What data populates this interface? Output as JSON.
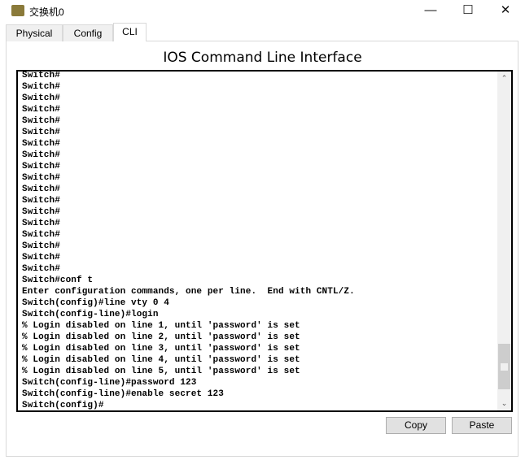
{
  "window": {
    "title": "交换机0",
    "icon": "switch-device-icon",
    "controls": [
      "minimize",
      "maximize",
      "close"
    ]
  },
  "tabs": [
    {
      "label": "Physical"
    },
    {
      "label": "Config"
    },
    {
      "label": "CLI",
      "active": true
    }
  ],
  "heading": "IOS Command Line Interface",
  "terminal": {
    "lines": [
      "Switch#",
      "Switch#",
      "Switch#",
      "Switch#",
      "Switch#",
      "Switch#",
      "Switch#",
      "Switch#",
      "Switch#",
      "Switch#",
      "Switch#",
      "Switch#",
      "Switch#",
      "Switch#",
      "Switch#",
      "Switch#",
      "Switch#",
      "Switch#",
      "Switch#conf t",
      "Enter configuration commands, one per line.  End with CNTL/Z.",
      "Switch(config)#line vty 0 4",
      "Switch(config-line)#login",
      "% Login disabled on line 1, until 'password' is set",
      "% Login disabled on line 2, until 'password' is set",
      "% Login disabled on line 3, until 'password' is set",
      "% Login disabled on line 4, until 'password' is set",
      "% Login disabled on line 5, until 'password' is set",
      "Switch(config-line)#password 123",
      "Switch(config-line)#enable secret 123",
      "Switch(config)#"
    ],
    "scroll_position_percent": 100
  },
  "buttons": {
    "copy": "Copy",
    "paste": "Paste"
  }
}
